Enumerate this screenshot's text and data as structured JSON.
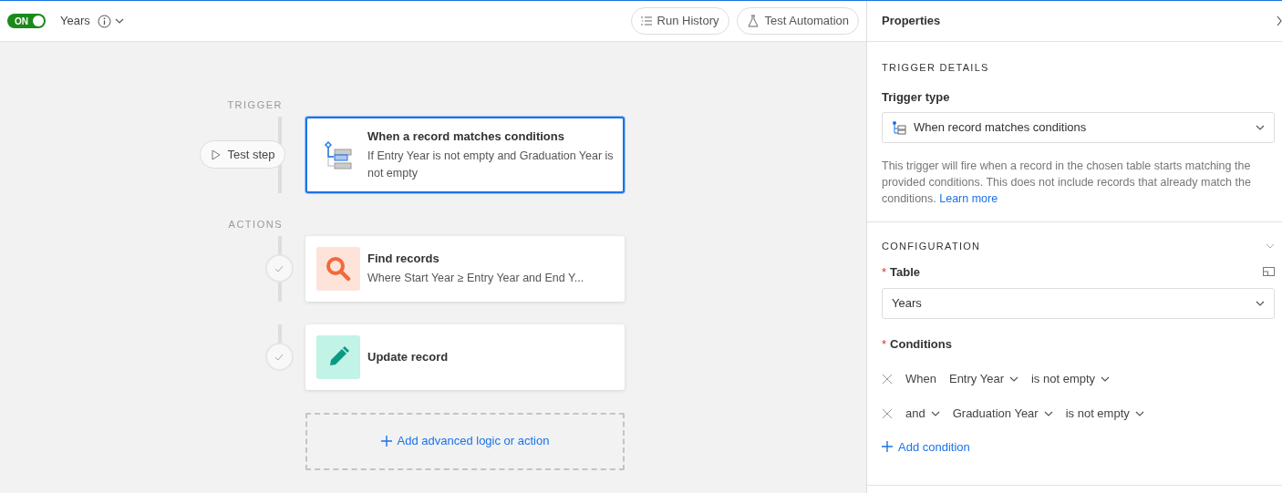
{
  "toolbar": {
    "toggle": {
      "on": true,
      "label": "ON"
    },
    "title": "Years",
    "buttons": [
      {
        "kind": "history",
        "label": "Run History"
      },
      {
        "kind": "test",
        "label": "Test Automation"
      }
    ]
  },
  "flow": {
    "sections": [
      {
        "label": "TRIGGER",
        "steps": [
          {
            "kind": "trigger",
            "title": "When a record matches conditions",
            "subtitle": "If Entry Year is not empty and Graduation Year is not empty",
            "selected": true,
            "status": {
              "kind": "test",
              "label": "Test step"
            }
          }
        ]
      },
      {
        "label": "ACTIONS",
        "steps": [
          {
            "kind": "find",
            "title": "Find records",
            "subtitle": "Where Start Year ≥ Entry Year and End Y...",
            "selected": false,
            "status": {
              "kind": "done"
            }
          },
          {
            "kind": "update",
            "title": "Update record",
            "selected": false,
            "status": {
              "kind": "done"
            }
          }
        ]
      }
    ],
    "add_button": "Add advanced logic or action"
  },
  "properties": {
    "title": "Properties",
    "trigger_details": {
      "heading": "TRIGGER DETAILS",
      "field_label": "Trigger type",
      "value": "When record matches conditions",
      "description": "This trigger will fire when a record in the chosen table starts matching the provided conditions. This does not include records that already match the conditions.",
      "link": "Learn more"
    },
    "configuration": {
      "heading": "CONFIGURATION",
      "expanded": true,
      "required_mark": "*",
      "table_label": "Table",
      "table_value": "Years",
      "conditions_label": "Conditions",
      "conditions": [
        {
          "connector": "When",
          "connector_dropdown": false,
          "field": "Entry Year",
          "operator": "is not empty"
        },
        {
          "connector": "and",
          "connector_dropdown": true,
          "field": "Graduation Year",
          "operator": "is not empty"
        }
      ],
      "add_condition": "Add condition"
    }
  }
}
